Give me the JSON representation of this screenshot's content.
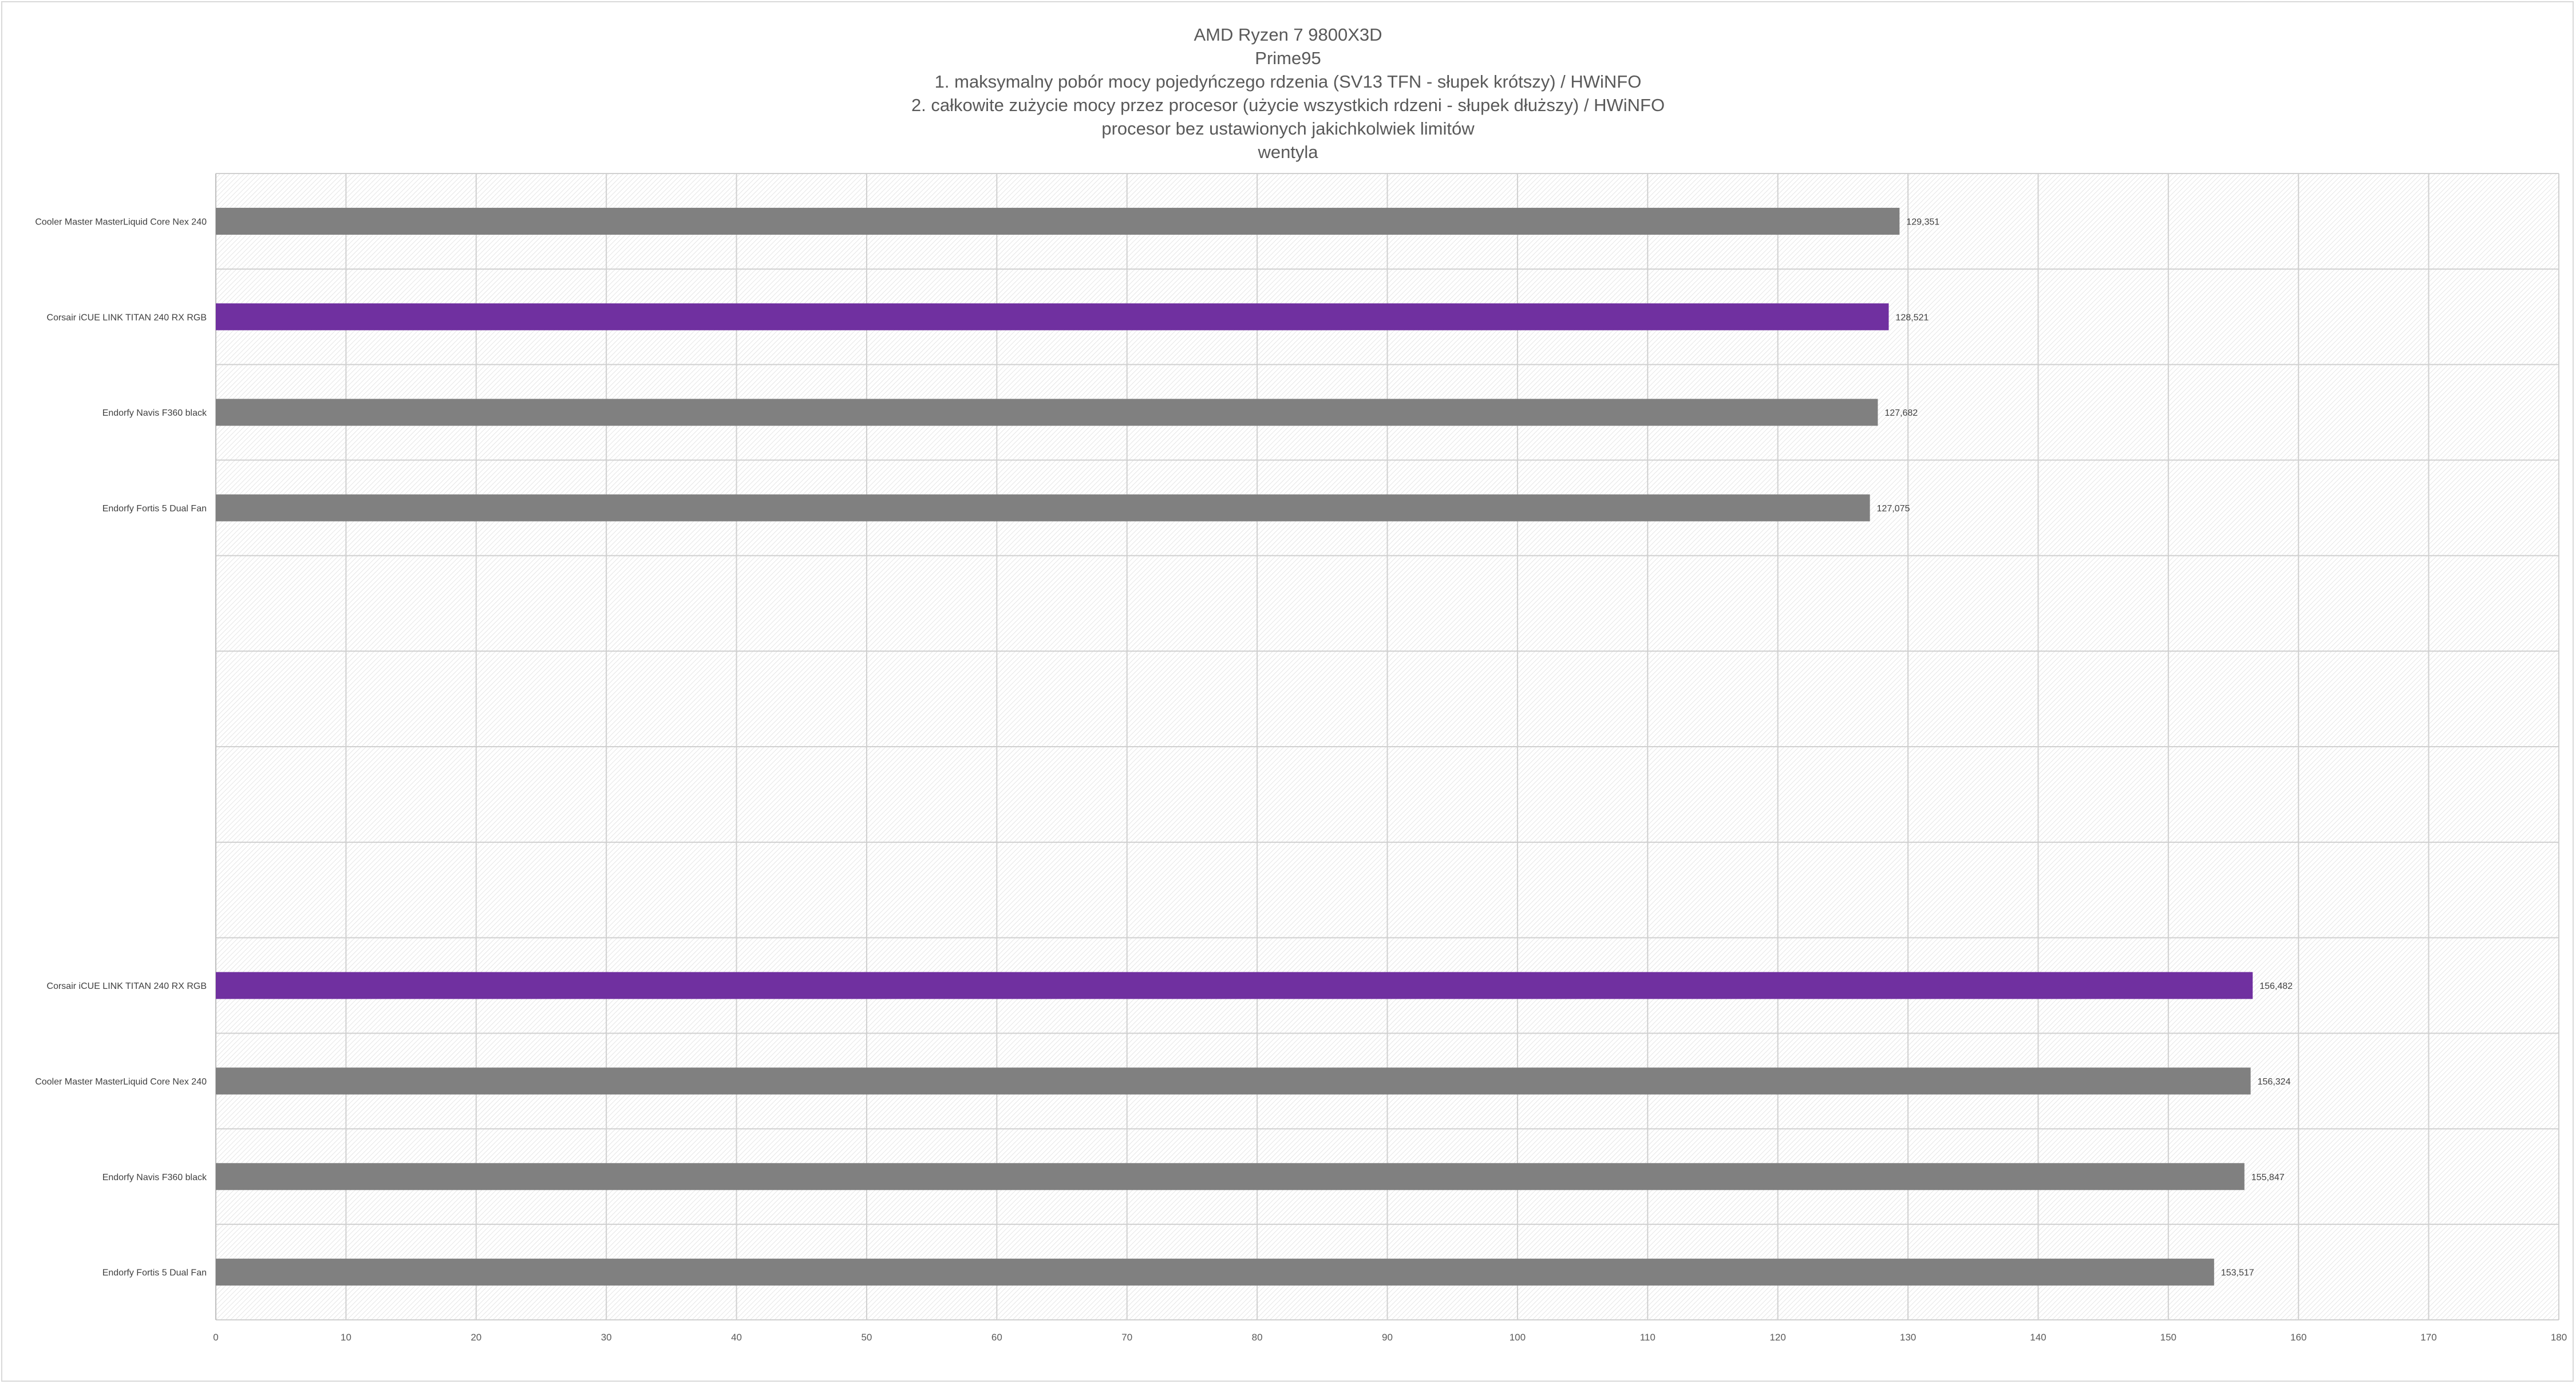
{
  "chart_data": {
    "type": "bar",
    "orientation": "horizontal",
    "title_lines": [
      "AMD Ryzen 7 9800X3D",
      "Prime95",
      "1. maksymalny pobór mocy pojedyńczego rdzenia (SV13 TFN - słupek krótszy) / HWiNFO",
      "2. całkowite zużycie mocy przez procesor (użycie wszystkich rdzeni - słupek dłuższy) / HWiNFO",
      "procesor bez ustawionych jakichkolwiek limitów",
      "wentyla"
    ],
    "xlim": [
      0,
      180
    ],
    "x_ticks": [
      0,
      10,
      20,
      30,
      40,
      50,
      60,
      70,
      80,
      90,
      100,
      110,
      120,
      130,
      140,
      150,
      160,
      170,
      180
    ],
    "grid": true,
    "rows": [
      {
        "label": "Cooler Master MasterLiquid Core Nex 240",
        "value": 129.351,
        "value_label": "129,351",
        "highlight": false
      },
      {
        "label": "Corsair iCUE LINK TITAN 240 RX RGB",
        "value": 128.521,
        "value_label": "128,521",
        "highlight": true
      },
      {
        "label": "Endorfy Navis F360 black",
        "value": 127.682,
        "value_label": "127,682",
        "highlight": false
      },
      {
        "label": "Endorfy Fortis 5 Dual Fan",
        "value": 127.075,
        "value_label": "127,075",
        "highlight": false
      },
      null,
      null,
      null,
      null,
      {
        "label": "Corsair iCUE LINK TITAN 240 RX RGB",
        "value": 156.482,
        "value_label": "156,482",
        "highlight": true
      },
      {
        "label": "Cooler Master MasterLiquid Core Nex 240",
        "value": 156.324,
        "value_label": "156,324",
        "highlight": false
      },
      {
        "label": "Endorfy Navis F360 black",
        "value": 155.847,
        "value_label": "155,847",
        "highlight": false
      },
      {
        "label": "Endorfy Fortis 5 Dual Fan",
        "value": 153.517,
        "value_label": "153,517",
        "highlight": false
      }
    ],
    "colors": {
      "default_bar": "#808080",
      "highlight_bar": "#7030a0"
    }
  }
}
